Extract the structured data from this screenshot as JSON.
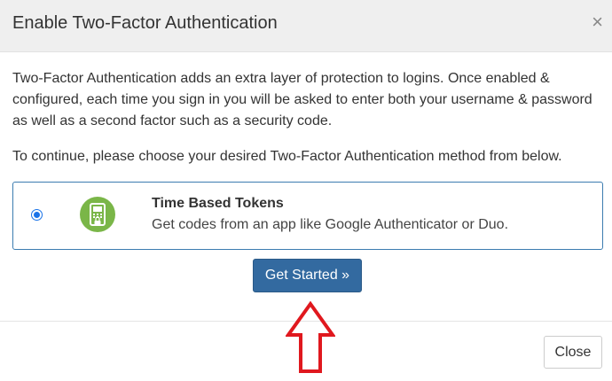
{
  "modal": {
    "title": "Enable Two-Factor Authentication",
    "close_symbol": "×",
    "paragraph1": "Two-Factor Authentication adds an extra layer of protection to logins. Once enabled & configured, each time you sign in you will be asked to enter both your username & password as well as a second factor such as a security code.",
    "paragraph2": "To continue, please choose your desired Two-Factor Authentication method from below."
  },
  "method": {
    "title": "Time Based Tokens",
    "description": "Get codes from an app like Google Authenticator or Duo.",
    "selected": true,
    "icon": "token-device-icon"
  },
  "buttons": {
    "get_started": "Get Started »",
    "close": "Close"
  },
  "colors": {
    "primary": "#336aa0",
    "option_border": "#3c7cb0",
    "icon_green": "#7ab648",
    "arrow_red": "#e0181e"
  }
}
